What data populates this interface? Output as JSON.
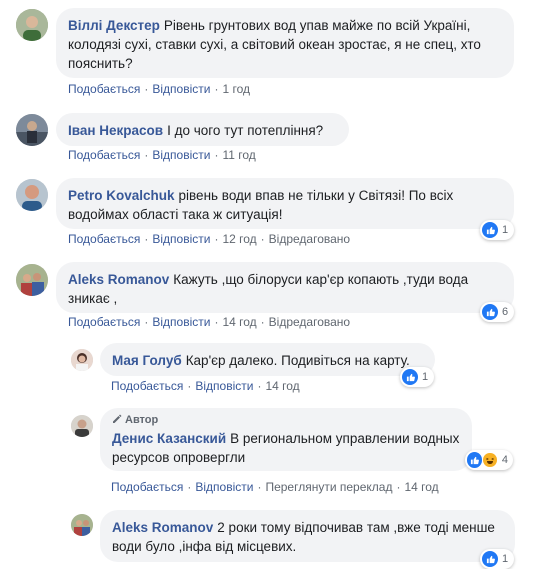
{
  "comments": [
    {
      "author": "Віллі Декстер",
      "text": "Рівень грунтових вод упав майже по всій Україні, колодязі сухі, ставки сухі, а світовий океан зростає, я не спец, хто пояснить?",
      "like": "Подобається",
      "reply": "Відповісти",
      "time": "1 год"
    },
    {
      "author": "Іван Некрасов",
      "text": "І до чого тут потепління?",
      "like": "Подобається",
      "reply": "Відповісти",
      "time": "11 год"
    },
    {
      "author": "Petro Kovalchuk",
      "text": "рівень води впав не тільки у Світязі! По всіх водоймах області така ж ситуація!",
      "like": "Подобається",
      "reply": "Відповісти",
      "time": "12 год",
      "edited": "Відредаговано",
      "reactions": "1"
    },
    {
      "author": "Aleks Romanov",
      "text": "Кажуть ,що білоруси кар'єр копають ,туди вода зникає ,",
      "like": "Подобається",
      "reply": "Відповісти",
      "time": "14 год",
      "edited": "Відредаговано",
      "reactions": "6"
    }
  ],
  "replies": [
    {
      "author": "Мая Голуб",
      "text": "Кар'єр далеко. Подивіться на карту.",
      "like": "Подобається",
      "reply": "Відповісти",
      "time": "14 год",
      "reactions": "1"
    },
    {
      "badge": "Автор",
      "author": "Денис Казанский",
      "text": "В региональном управлении водных ресурсов опровергли",
      "like": "Подобається",
      "reply": "Відповісти",
      "translate": "Переглянути переклад",
      "time": "14 год",
      "reactions": "4"
    },
    {
      "author": "Aleks Romanov",
      "text": "2 роки тому відпочивав там ,вже тоді менше води було ,інфа від місцевих.",
      "reactions": "1"
    }
  ],
  "icons": {
    "like": "like-icon",
    "haha": "haha-icon",
    "pencil": "pencil-icon"
  },
  "colors": {
    "author": "#385898",
    "bubble": "#f2f3f5",
    "meta": "#606770",
    "like_blue": "#2078f4",
    "haha_yellow": "#f7b125"
  }
}
